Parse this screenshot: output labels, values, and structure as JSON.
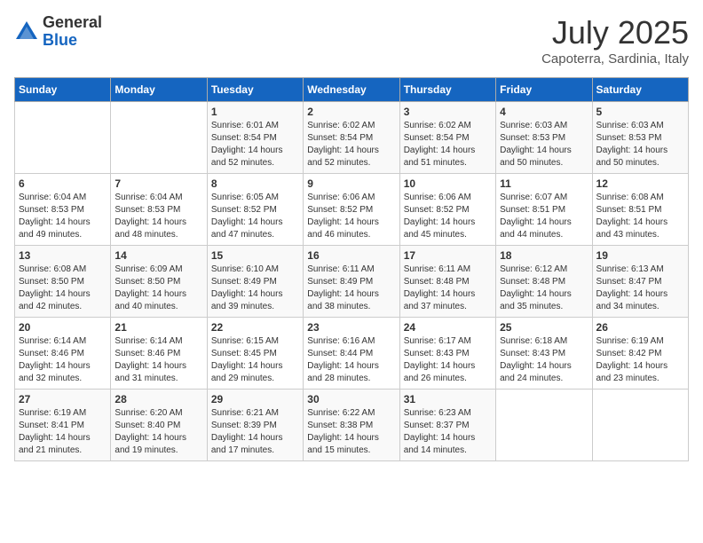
{
  "logo": {
    "general": "General",
    "blue": "Blue"
  },
  "title": "July 2025",
  "subtitle": "Capoterra, Sardinia, Italy",
  "days_header": [
    "Sunday",
    "Monday",
    "Tuesday",
    "Wednesday",
    "Thursday",
    "Friday",
    "Saturday"
  ],
  "weeks": [
    [
      {
        "day": "",
        "sunrise": "",
        "sunset": "",
        "daylight": ""
      },
      {
        "day": "",
        "sunrise": "",
        "sunset": "",
        "daylight": ""
      },
      {
        "day": "1",
        "sunrise": "Sunrise: 6:01 AM",
        "sunset": "Sunset: 8:54 PM",
        "daylight": "Daylight: 14 hours and 52 minutes."
      },
      {
        "day": "2",
        "sunrise": "Sunrise: 6:02 AM",
        "sunset": "Sunset: 8:54 PM",
        "daylight": "Daylight: 14 hours and 52 minutes."
      },
      {
        "day": "3",
        "sunrise": "Sunrise: 6:02 AM",
        "sunset": "Sunset: 8:54 PM",
        "daylight": "Daylight: 14 hours and 51 minutes."
      },
      {
        "day": "4",
        "sunrise": "Sunrise: 6:03 AM",
        "sunset": "Sunset: 8:53 PM",
        "daylight": "Daylight: 14 hours and 50 minutes."
      },
      {
        "day": "5",
        "sunrise": "Sunrise: 6:03 AM",
        "sunset": "Sunset: 8:53 PM",
        "daylight": "Daylight: 14 hours and 50 minutes."
      }
    ],
    [
      {
        "day": "6",
        "sunrise": "Sunrise: 6:04 AM",
        "sunset": "Sunset: 8:53 PM",
        "daylight": "Daylight: 14 hours and 49 minutes."
      },
      {
        "day": "7",
        "sunrise": "Sunrise: 6:04 AM",
        "sunset": "Sunset: 8:53 PM",
        "daylight": "Daylight: 14 hours and 48 minutes."
      },
      {
        "day": "8",
        "sunrise": "Sunrise: 6:05 AM",
        "sunset": "Sunset: 8:52 PM",
        "daylight": "Daylight: 14 hours and 47 minutes."
      },
      {
        "day": "9",
        "sunrise": "Sunrise: 6:06 AM",
        "sunset": "Sunset: 8:52 PM",
        "daylight": "Daylight: 14 hours and 46 minutes."
      },
      {
        "day": "10",
        "sunrise": "Sunrise: 6:06 AM",
        "sunset": "Sunset: 8:52 PM",
        "daylight": "Daylight: 14 hours and 45 minutes."
      },
      {
        "day": "11",
        "sunrise": "Sunrise: 6:07 AM",
        "sunset": "Sunset: 8:51 PM",
        "daylight": "Daylight: 14 hours and 44 minutes."
      },
      {
        "day": "12",
        "sunrise": "Sunrise: 6:08 AM",
        "sunset": "Sunset: 8:51 PM",
        "daylight": "Daylight: 14 hours and 43 minutes."
      }
    ],
    [
      {
        "day": "13",
        "sunrise": "Sunrise: 6:08 AM",
        "sunset": "Sunset: 8:50 PM",
        "daylight": "Daylight: 14 hours and 42 minutes."
      },
      {
        "day": "14",
        "sunrise": "Sunrise: 6:09 AM",
        "sunset": "Sunset: 8:50 PM",
        "daylight": "Daylight: 14 hours and 40 minutes."
      },
      {
        "day": "15",
        "sunrise": "Sunrise: 6:10 AM",
        "sunset": "Sunset: 8:49 PM",
        "daylight": "Daylight: 14 hours and 39 minutes."
      },
      {
        "day": "16",
        "sunrise": "Sunrise: 6:11 AM",
        "sunset": "Sunset: 8:49 PM",
        "daylight": "Daylight: 14 hours and 38 minutes."
      },
      {
        "day": "17",
        "sunrise": "Sunrise: 6:11 AM",
        "sunset": "Sunset: 8:48 PM",
        "daylight": "Daylight: 14 hours and 37 minutes."
      },
      {
        "day": "18",
        "sunrise": "Sunrise: 6:12 AM",
        "sunset": "Sunset: 8:48 PM",
        "daylight": "Daylight: 14 hours and 35 minutes."
      },
      {
        "day": "19",
        "sunrise": "Sunrise: 6:13 AM",
        "sunset": "Sunset: 8:47 PM",
        "daylight": "Daylight: 14 hours and 34 minutes."
      }
    ],
    [
      {
        "day": "20",
        "sunrise": "Sunrise: 6:14 AM",
        "sunset": "Sunset: 8:46 PM",
        "daylight": "Daylight: 14 hours and 32 minutes."
      },
      {
        "day": "21",
        "sunrise": "Sunrise: 6:14 AM",
        "sunset": "Sunset: 8:46 PM",
        "daylight": "Daylight: 14 hours and 31 minutes."
      },
      {
        "day": "22",
        "sunrise": "Sunrise: 6:15 AM",
        "sunset": "Sunset: 8:45 PM",
        "daylight": "Daylight: 14 hours and 29 minutes."
      },
      {
        "day": "23",
        "sunrise": "Sunrise: 6:16 AM",
        "sunset": "Sunset: 8:44 PM",
        "daylight": "Daylight: 14 hours and 28 minutes."
      },
      {
        "day": "24",
        "sunrise": "Sunrise: 6:17 AM",
        "sunset": "Sunset: 8:43 PM",
        "daylight": "Daylight: 14 hours and 26 minutes."
      },
      {
        "day": "25",
        "sunrise": "Sunrise: 6:18 AM",
        "sunset": "Sunset: 8:43 PM",
        "daylight": "Daylight: 14 hours and 24 minutes."
      },
      {
        "day": "26",
        "sunrise": "Sunrise: 6:19 AM",
        "sunset": "Sunset: 8:42 PM",
        "daylight": "Daylight: 14 hours and 23 minutes."
      }
    ],
    [
      {
        "day": "27",
        "sunrise": "Sunrise: 6:19 AM",
        "sunset": "Sunset: 8:41 PM",
        "daylight": "Daylight: 14 hours and 21 minutes."
      },
      {
        "day": "28",
        "sunrise": "Sunrise: 6:20 AM",
        "sunset": "Sunset: 8:40 PM",
        "daylight": "Daylight: 14 hours and 19 minutes."
      },
      {
        "day": "29",
        "sunrise": "Sunrise: 6:21 AM",
        "sunset": "Sunset: 8:39 PM",
        "daylight": "Daylight: 14 hours and 17 minutes."
      },
      {
        "day": "30",
        "sunrise": "Sunrise: 6:22 AM",
        "sunset": "Sunset: 8:38 PM",
        "daylight": "Daylight: 14 hours and 15 minutes."
      },
      {
        "day": "31",
        "sunrise": "Sunrise: 6:23 AM",
        "sunset": "Sunset: 8:37 PM",
        "daylight": "Daylight: 14 hours and 14 minutes."
      },
      {
        "day": "",
        "sunrise": "",
        "sunset": "",
        "daylight": ""
      },
      {
        "day": "",
        "sunrise": "",
        "sunset": "",
        "daylight": ""
      }
    ]
  ]
}
